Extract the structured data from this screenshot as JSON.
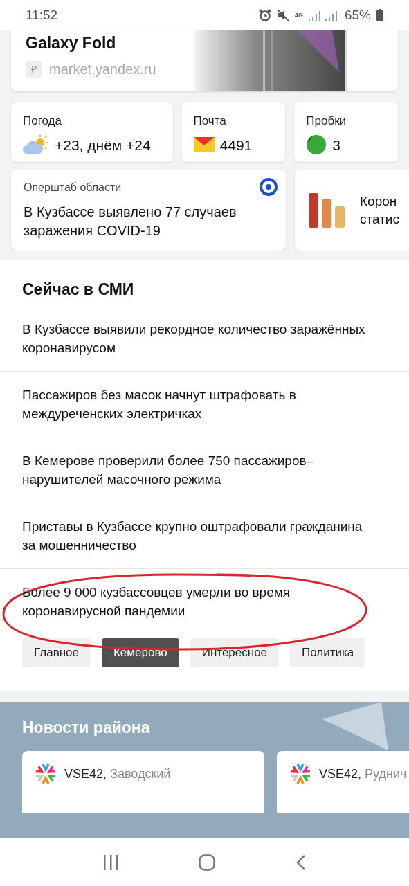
{
  "status_bar": {
    "time": "11:52",
    "network": "4G",
    "battery": "65%"
  },
  "promo": {
    "title": "Galaxy Fold",
    "source": "market.yandex.ru",
    "source_icon": "₽"
  },
  "widgets": [
    {
      "kind": "weather",
      "label": "Погода",
      "value": "+23, днём +24"
    },
    {
      "kind": "mail",
      "label": "Почта",
      "value": "4491"
    },
    {
      "kind": "traffic",
      "label": "Пробки",
      "value": "3"
    }
  ],
  "info_cards": [
    {
      "kind": "news",
      "source": "Оперштаб области",
      "text": "В Кузбассе выявлено 77 случаев заражения COVID-19"
    },
    {
      "kind": "stats",
      "text_lines": [
        "Корон",
        "статис"
      ]
    }
  ],
  "media": {
    "title": "Сейчас в СМИ",
    "headlines": [
      {
        "text": "В Кузбассе выявили рекордное количество заражённых коронавирусом",
        "circled": false
      },
      {
        "text": "Пассажиров без масок начнут штрафовать в междуреченских электричках",
        "circled": false
      },
      {
        "text": "В Кемерове проверили более 750 пассажиров–нарушителей масочного режима",
        "circled": false
      },
      {
        "text": "Приставы в Кузбассе крупно оштрафовали гражданина за мошенничество",
        "circled": false
      },
      {
        "text": "Более 9 000 кузбассовцев умерли во время коронавирусной пандемии",
        "circled": true
      }
    ],
    "tabs": [
      {
        "label": "Главное",
        "selected": false
      },
      {
        "label": "Кемерово",
        "selected": true
      },
      {
        "label": "Интересное",
        "selected": false
      },
      {
        "label": "Политика",
        "selected": false
      }
    ]
  },
  "district": {
    "title": "Новости района",
    "cards": [
      {
        "source": "VSE42,",
        "area": "Заводский"
      },
      {
        "source": "VSE42,",
        "area": "Руднич"
      }
    ]
  }
}
